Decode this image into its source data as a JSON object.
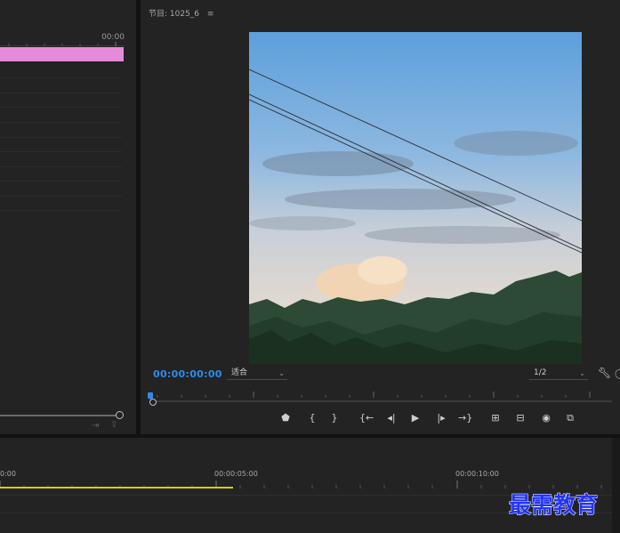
{
  "source_panel": {
    "timecode": "00:00",
    "clip_color": "#e68bd9",
    "footer_icons": [
      "insert-icon",
      "export-icon"
    ]
  },
  "program_monitor": {
    "title": "节目: 1025_6",
    "menu_icon": "hamburger-icon",
    "current_timecode": "00:00:00:00",
    "timecode_color": "#2d8ceb",
    "fit_select": "适合",
    "resolution_select": "1/2",
    "settings_icon": "wrench-icon",
    "controls": [
      {
        "name": "add-marker-button",
        "glyph": "⬟",
        "icon": "marker-icon"
      },
      {
        "name": "mark-in-button",
        "glyph": "{",
        "icon": "mark-in-icon"
      },
      {
        "name": "mark-out-button",
        "glyph": "}",
        "icon": "mark-out-icon"
      },
      {
        "name": "go-to-in-button",
        "glyph": "{←",
        "icon": "go-to-in-icon"
      },
      {
        "name": "step-back-button",
        "glyph": "◂|",
        "icon": "step-back-icon"
      },
      {
        "name": "play-button",
        "glyph": "▶",
        "icon": "play-icon"
      },
      {
        "name": "step-forward-button",
        "glyph": "|▸",
        "icon": "step-forward-icon"
      },
      {
        "name": "go-to-out-button",
        "glyph": "→}",
        "icon": "go-to-out-icon"
      },
      {
        "name": "lift-button",
        "glyph": "⊞",
        "icon": "lift-icon"
      },
      {
        "name": "extract-button",
        "glyph": "⊟",
        "icon": "extract-icon"
      },
      {
        "name": "export-frame-button",
        "glyph": "◉",
        "icon": "camera-icon"
      },
      {
        "name": "comparison-view-button",
        "glyph": "⧉",
        "icon": "compare-icon"
      }
    ]
  },
  "timeline": {
    "labels": [
      "0:00",
      "00:00:05:00",
      "00:00:10:00"
    ],
    "work_area_color": "#d6d200"
  },
  "watermark": "最需教育"
}
